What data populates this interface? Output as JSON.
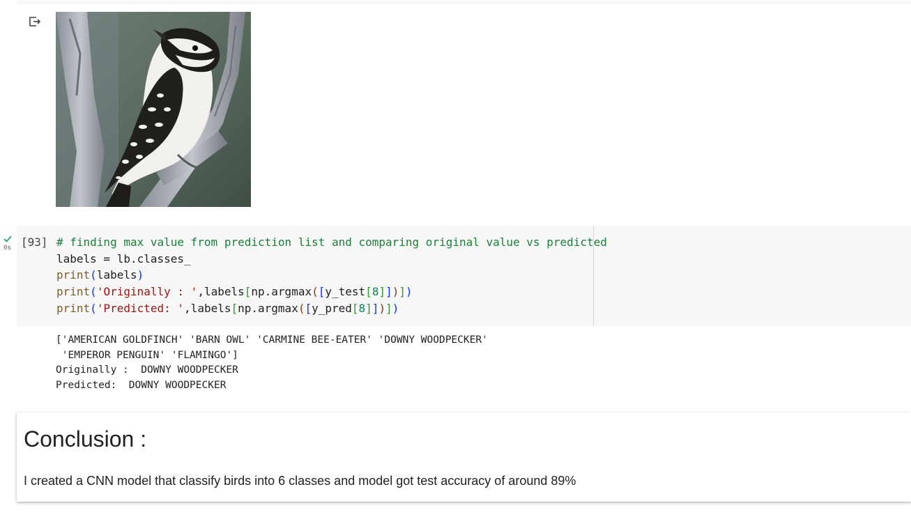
{
  "output_cell": {
    "icon": "output-arrow-icon",
    "image": {
      "subject": "downy woodpecker on branch"
    }
  },
  "code_cell": {
    "execution_count": "[93]",
    "exec_time": "0s",
    "status_icon": "check-icon",
    "lines": [
      {
        "tokens": [
          {
            "text": "# finding max value from prediction list and comparing original value vs predicted",
            "cls": "c-comment"
          }
        ]
      },
      {
        "tokens": [
          {
            "text": "labels = lb.classes_",
            "cls": ""
          }
        ]
      },
      {
        "tokens": [
          {
            "text": "print",
            "cls": "c-builtin"
          },
          {
            "text": "(",
            "cls": "c-p1"
          },
          {
            "text": "labels",
            "cls": ""
          },
          {
            "text": ")",
            "cls": "c-p1"
          }
        ]
      },
      {
        "tokens": [
          {
            "text": "print",
            "cls": "c-builtin"
          },
          {
            "text": "(",
            "cls": "c-p1"
          },
          {
            "text": "'Originally : '",
            "cls": "c-string"
          },
          {
            "text": ",labels",
            "cls": ""
          },
          {
            "text": "[",
            "cls": "c-p2"
          },
          {
            "text": "np.argmax",
            "cls": ""
          },
          {
            "text": "(",
            "cls": "c-p3"
          },
          {
            "text": "[",
            "cls": "c-p1"
          },
          {
            "text": "y_test",
            "cls": ""
          },
          {
            "text": "[",
            "cls": "c-p2"
          },
          {
            "text": "8",
            "cls": "c-num"
          },
          {
            "text": "]",
            "cls": "c-p2"
          },
          {
            "text": "]",
            "cls": "c-p1"
          },
          {
            "text": ")",
            "cls": "c-p3"
          },
          {
            "text": "]",
            "cls": "c-p2"
          },
          {
            "text": ")",
            "cls": "c-p1"
          }
        ]
      },
      {
        "tokens": [
          {
            "text": "print",
            "cls": "c-builtin"
          },
          {
            "text": "(",
            "cls": "c-p1"
          },
          {
            "text": "'Predicted: '",
            "cls": "c-string"
          },
          {
            "text": ",labels",
            "cls": ""
          },
          {
            "text": "[",
            "cls": "c-p2"
          },
          {
            "text": "np.argmax",
            "cls": ""
          },
          {
            "text": "(",
            "cls": "c-p3"
          },
          {
            "text": "[",
            "cls": "c-p1"
          },
          {
            "text": "y_pred",
            "cls": ""
          },
          {
            "text": "[",
            "cls": "c-p2"
          },
          {
            "text": "8",
            "cls": "c-num"
          },
          {
            "text": "]",
            "cls": "c-p2"
          },
          {
            "text": "]",
            "cls": "c-p1"
          },
          {
            "text": ")",
            "cls": "c-p3"
          },
          {
            "text": "]",
            "cls": "c-p2"
          },
          {
            "text": ")",
            "cls": "c-p1"
          }
        ]
      }
    ],
    "output_lines": [
      "['AMERICAN GOLDFINCH' 'BARN OWL' 'CARMINE BEE-EATER' 'DOWNY WOODPECKER'",
      " 'EMPEROR PENGUIN' 'FLAMINGO']",
      "Originally :  DOWNY WOODPECKER",
      "Predicted:  DOWNY WOODPECKER"
    ]
  },
  "markdown_cell": {
    "heading": "Conclusion :",
    "paragraph": "I created a CNN model that classify birds into 6 classes and model got test accuracy of around 89%"
  }
}
